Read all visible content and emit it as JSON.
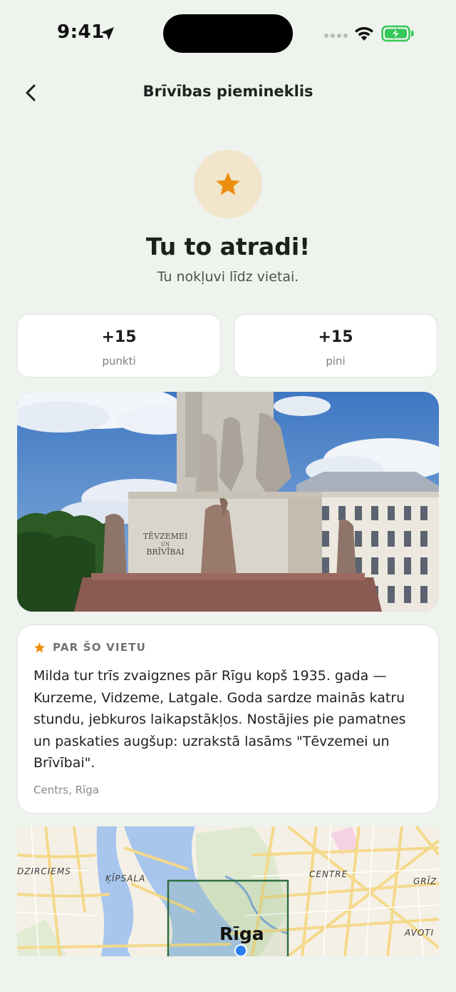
{
  "status_bar": {
    "time": "9:41"
  },
  "nav": {
    "title": "Brīvības piemineklis"
  },
  "hero": {
    "headline": "Tu to atradi!",
    "subline": "Tu nokļuvi līdz vietai."
  },
  "stats": [
    {
      "value": "+15",
      "label": "punkti"
    },
    {
      "value": "+15",
      "label": "pini"
    }
  ],
  "photo": {
    "engraving": [
      "TĒVZEMEI",
      "UN",
      "BRĪVĪBAI"
    ]
  },
  "about": {
    "title": "PAR ŠO VIETU",
    "lines": [
      "Milda tur trīs zvaigznes pār Rīgu kopš 1935. gada —",
      "Kurzeme, Vidzeme, Latgale. Goda sardze mainās katru",
      "stundu, jebkuros laikapstākļos. Nostājies pie pamatnes",
      "un paskaties augšup: uzrakstā lasāms \"Tēvzemei un",
      "Brīvībai\"."
    ],
    "location": "Centrs, Rīga"
  },
  "map": {
    "labels": {
      "dzirciems": "DZIRCIEMS",
      "kipsala": "ĶĪPSALA",
      "centre": "CENTRE",
      "griz": "GRĪZ",
      "avoti": "AVOTI"
    },
    "city": "Rīga"
  },
  "colors": {
    "background": "#eff3ed",
    "accent_star": "#ec8f0e",
    "star_circle": "#f1e6cc",
    "map_frame": "#2f6e45",
    "location_dot": "#2a7df0"
  }
}
